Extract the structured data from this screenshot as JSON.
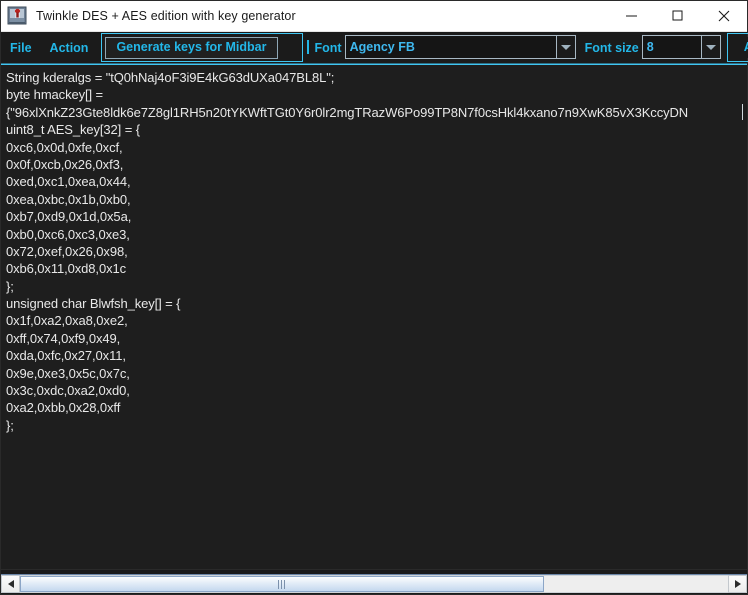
{
  "window": {
    "title": "Twinkle DES + AES edition with key generator",
    "icon": "app-icon",
    "controls": {
      "minimize": "minimize-icon",
      "maximize": "maximize-icon",
      "close": "close-icon"
    }
  },
  "toolbar": {
    "menus": [
      {
        "label": "File"
      },
      {
        "label": "Action"
      }
    ],
    "generate_button": "Generate keys for Midbar",
    "separator": "|",
    "font_label": "Font",
    "font_value": "Agency FB",
    "font_placeholder": "Agency FB",
    "font_size_label": "Font size",
    "font_size_value": "8",
    "font_size_placeholder": "8",
    "apply_label": "Apply",
    "dropdown_icon": "chevron-down-icon"
  },
  "editor": {
    "lines": [
      "String kderalgs = \"tQ0hNaj4oF3i9E4kG63dUXa047BL8L\";",
      "byte hmackey[] =",
      "{\"96xlXnkZ23Gte8ldk6e7Z8gl1RH5n20tYKWftTGt0Y6r0lr2mgTRazW6Po99TP8N7f0csHkl4kxano7n9XwK85vX3KccyDN",
      "uint8_t AES_key[32] = {",
      "0xc6,0x0d,0xfe,0xcf,",
      "0x0f,0xcb,0x26,0xf3,",
      "0xed,0xc1,0xea,0x44,",
      "0xea,0xbc,0x1b,0xb0,",
      "0xb7,0xd9,0x1d,0x5a,",
      "0xb0,0xc6,0xc3,0xe3,",
      "0x72,0xef,0x26,0x98,",
      "0xb6,0x11,0xd8,0x1c",
      "};",
      "unsigned char Blwfsh_key[] = {",
      "0x1f,0xa2,0xa8,0xe2,",
      "0xff,0x74,0xf9,0x49,",
      "0xda,0xfc,0x27,0x11,",
      "0x9e,0xe3,0x5c,0x7c,",
      "0x3c,0xdc,0xa2,0xd0,",
      "0xa2,0xbb,0x28,0xff",
      "};"
    ]
  },
  "scrollbar": {
    "left_arrow": "scroll-left-icon",
    "right_arrow": "scroll-right-icon",
    "thumb_grip": "grip-icon",
    "thumb_fraction_percent": "74"
  },
  "colors": {
    "accent": "#23b7e8",
    "titlebar_bg": "#ffffff",
    "toolbar_bg": "#1b1b1b",
    "editor_bg": "#1e1e1e",
    "code_text": "#e8e8e8"
  }
}
